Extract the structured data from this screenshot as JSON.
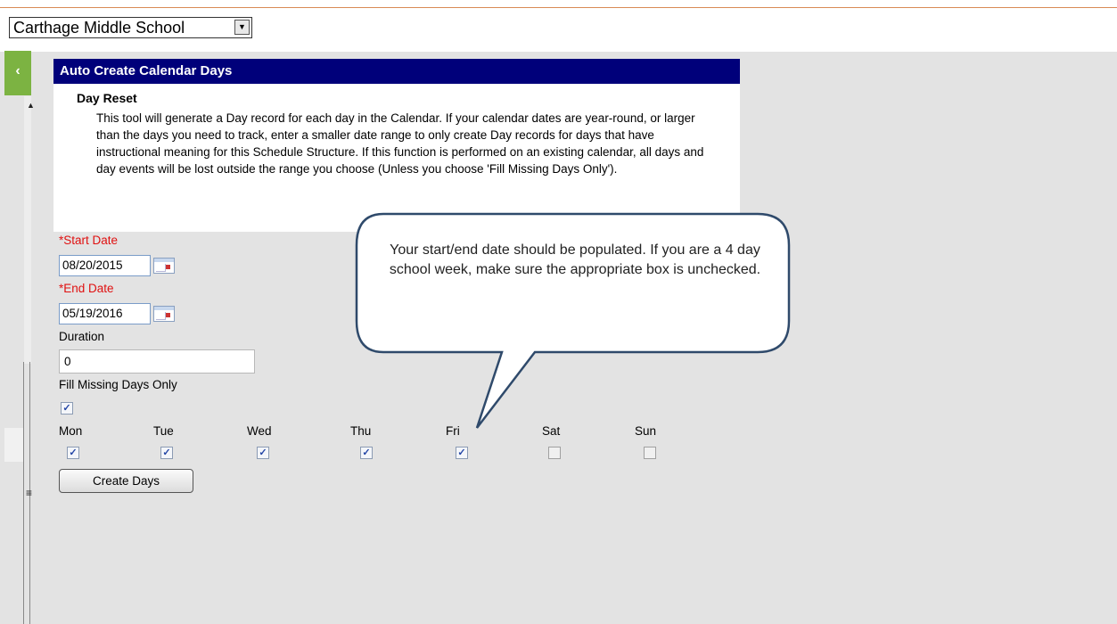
{
  "school_selector": {
    "value": "Carthage Middle School",
    "arrow_icon": "chevron-down-icon"
  },
  "sidebar": {
    "collapse_label": "‹"
  },
  "panel": {
    "title": "Auto Create Calendar Days",
    "section_title": "Day Reset",
    "description": "This tool will generate a Day record for each day in the Calendar. If your calendar dates are year-round, or larger than the days you need to track, enter a smaller date range to only create Day records for days that have instructional meaning for this Schedule Structure. If this function is performed on an existing calendar, all days and day events will be lost outside the range you choose (Unless you choose 'Fill Missing Days Only')."
  },
  "form": {
    "start_date_label": "*Start Date",
    "start_date_value": "08/20/2015",
    "end_date_label": "*End Date",
    "end_date_value": "05/19/2016",
    "duration_label": "Duration",
    "duration_value": "0",
    "fill_missing_label": "Fill Missing Days Only",
    "fill_missing_checked": true,
    "days": [
      {
        "label": "Mon",
        "checked": true
      },
      {
        "label": "Tue",
        "checked": true
      },
      {
        "label": "Wed",
        "checked": true
      },
      {
        "label": "Thu",
        "checked": true
      },
      {
        "label": "Fri",
        "checked": true
      },
      {
        "label": "Sat",
        "checked": false
      },
      {
        "label": "Sun",
        "checked": false
      }
    ],
    "create_button": "Create Days"
  },
  "callout": {
    "text": "Your start/end date should be populated.  If you are a 4 day school week, make sure the appropriate box is unchecked."
  },
  "colors": {
    "header_bg": "#00007a",
    "required_label": "#e01010",
    "collapse_tab": "#7cb342"
  }
}
